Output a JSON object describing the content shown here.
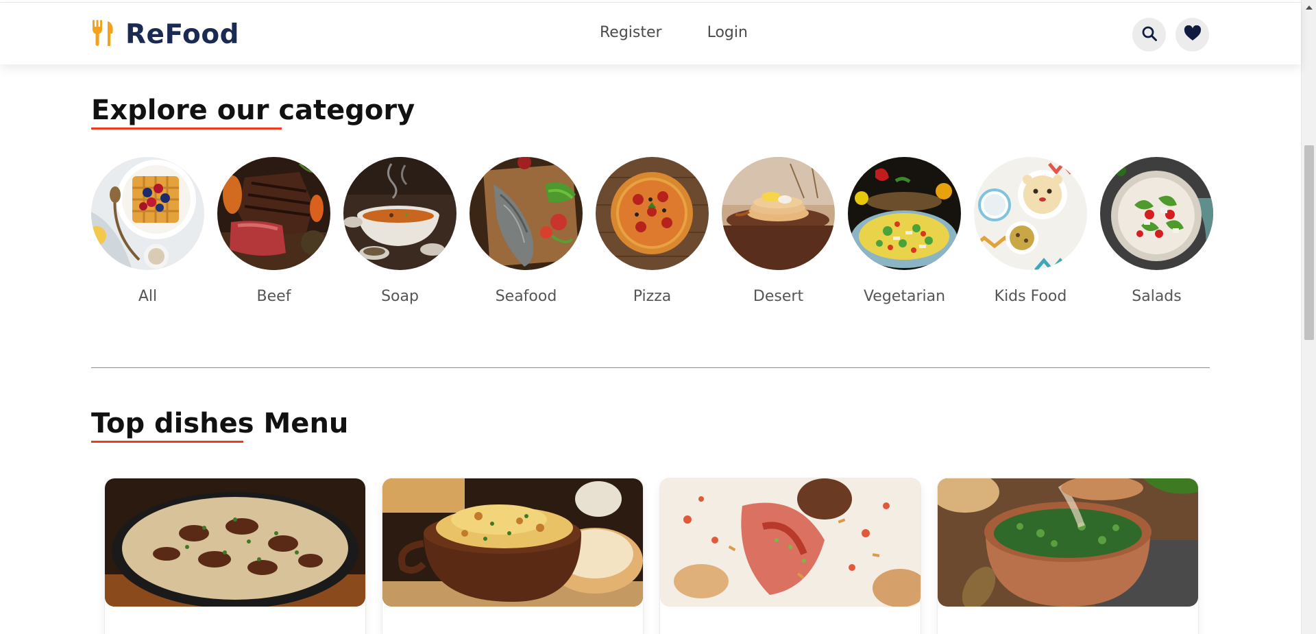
{
  "header": {
    "brand": "ReFood",
    "nav": [
      {
        "label": "Register"
      },
      {
        "label": "Login"
      }
    ],
    "search_icon": "search-icon",
    "favorites_icon": "heart-icon"
  },
  "categories_section": {
    "title": "Explore our category",
    "items": [
      {
        "label": "All"
      },
      {
        "label": "Beef"
      },
      {
        "label": "Soap"
      },
      {
        "label": "Seafood"
      },
      {
        "label": "Pizza"
      },
      {
        "label": "Desert"
      },
      {
        "label": "Vegetarian"
      },
      {
        "label": "Kids Food"
      },
      {
        "label": "Salads"
      }
    ]
  },
  "dishes_section": {
    "title": "Top dishes Menu"
  },
  "colors": {
    "brand_navy": "#1a2a52",
    "accent_orange": "#f4a21b",
    "underline_red": "#ee3b1f"
  }
}
